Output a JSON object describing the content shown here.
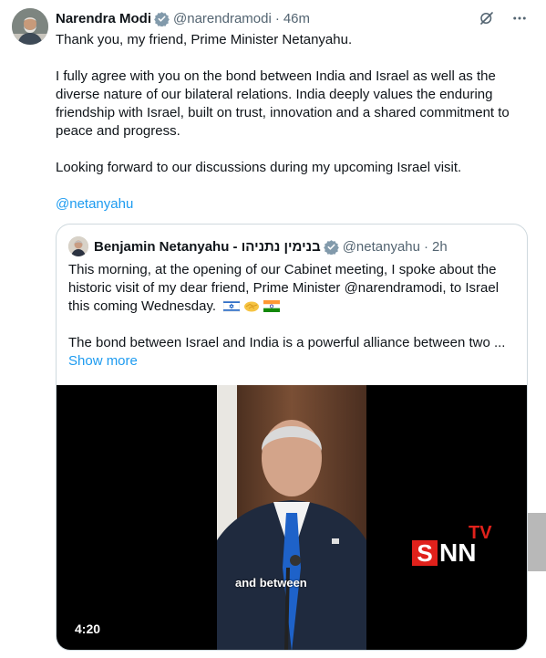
{
  "tweet": {
    "author_name": "Narendra Modi",
    "author_handle": "@narendramodi",
    "separator": "·",
    "time": "46m",
    "paragraphs": [
      "Thank you, my friend, Prime Minister Netanyahu.",
      "I fully agree with you on the bond between India and Israel as well as the diverse nature of our bilateral relations. India deeply values the enduring friendship with Israel, built on trust, innovation and a shared commitment to peace and progress.",
      "Looking forward to our discussions during my upcoming Israel visit."
    ],
    "mention": "@netanyahu"
  },
  "quote": {
    "author_name": "Benjamin Netanyahu - בנימין נתניהו",
    "author_handle": "@netanyahu",
    "separator": "·",
    "time": "2h",
    "paragraph_1": "This morning, at the opening of our Cabinet meeting, I spoke about the historic visit of my dear friend, Prime Minister @narendramodi, to Israel this coming Wednesday.",
    "paragraph_2": "The bond between Israel and India is a powerful alliance between two ...",
    "show_more": "Show more",
    "video": {
      "duration": "4:20",
      "caption": "and between",
      "logo_main": "SNN",
      "logo_sub": "TV"
    }
  },
  "icons": {
    "verified": "verified-badge-icon",
    "grok": "grok-icon",
    "more": "more-icon",
    "flags": [
      "israel-flag-icon",
      "handshake-icon",
      "india-flag-icon"
    ]
  },
  "colors": {
    "accent": "#1d9bf0",
    "text": "#0f1419",
    "muted": "#536471",
    "border": "#cfd9de",
    "logo_red": "#e0211b"
  }
}
